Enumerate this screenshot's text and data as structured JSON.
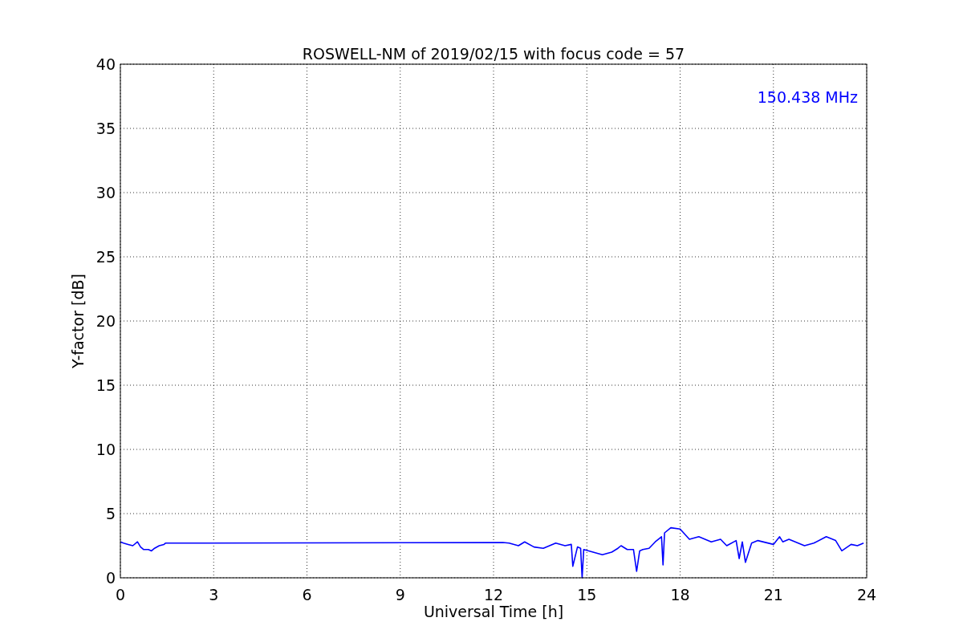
{
  "chart_data": {
    "type": "line",
    "title": "ROSWELL-NM of 2019/02/15 with focus code = 57",
    "xlabel": "Universal Time [h]",
    "ylabel": "Y-factor [dB]",
    "x": [
      0,
      0.1,
      0.25,
      0.4,
      0.55,
      0.65,
      0.75,
      0.9,
      1.0,
      1.1,
      1.25,
      1.4,
      1.45,
      12.3,
      12.5,
      12.8,
      13,
      13.3,
      13.6,
      14,
      14.3,
      14.5,
      14.55,
      14.7,
      14.8,
      14.85,
      14.9,
      15.2,
      15.5,
      15.8,
      16,
      16.1,
      16.3,
      16.5,
      16.6,
      16.7,
      16.8,
      17,
      17.2,
      17.4,
      17.45,
      17.5,
      17.7,
      18,
      18.3,
      18.6,
      19,
      19.3,
      19.5,
      19.8,
      19.9,
      20,
      20.1,
      20.3,
      20.5,
      21,
      21.2,
      21.3,
      21.5,
      22,
      22.3,
      22.7,
      23,
      23.2,
      23.5,
      23.7,
      23.9
    ],
    "series": [
      {
        "name": "150.438 MHz",
        "color": "#0000ff",
        "values": [
          2.8,
          2.7,
          2.6,
          2.5,
          2.8,
          2.4,
          2.2,
          2.2,
          2.1,
          2.3,
          2.5,
          2.6,
          2.7,
          2.75,
          2.7,
          2.5,
          2.8,
          2.4,
          2.3,
          2.7,
          2.5,
          2.6,
          0.9,
          2.4,
          2.3,
          0,
          2.2,
          2.0,
          1.8,
          2.0,
          2.3,
          2.5,
          2.2,
          2.2,
          0.5,
          2.1,
          2.2,
          2.3,
          2.8,
          3.2,
          1.0,
          3.5,
          3.9,
          3.8,
          3.0,
          3.2,
          2.8,
          3.0,
          2.5,
          2.9,
          1.5,
          2.8,
          1.2,
          2.7,
          2.9,
          2.6,
          3.2,
          2.8,
          3.0,
          2.5,
          2.7,
          3.2,
          2.9,
          2.1,
          2.6,
          2.5,
          2.7
        ]
      }
    ],
    "xlim": [
      0,
      24
    ],
    "ylim": [
      0,
      40
    ],
    "xticks": [
      0,
      3,
      6,
      9,
      12,
      15,
      18,
      21,
      24
    ],
    "yticks": [
      0,
      5,
      10,
      15,
      20,
      25,
      30,
      35,
      40
    ],
    "grid": true
  }
}
